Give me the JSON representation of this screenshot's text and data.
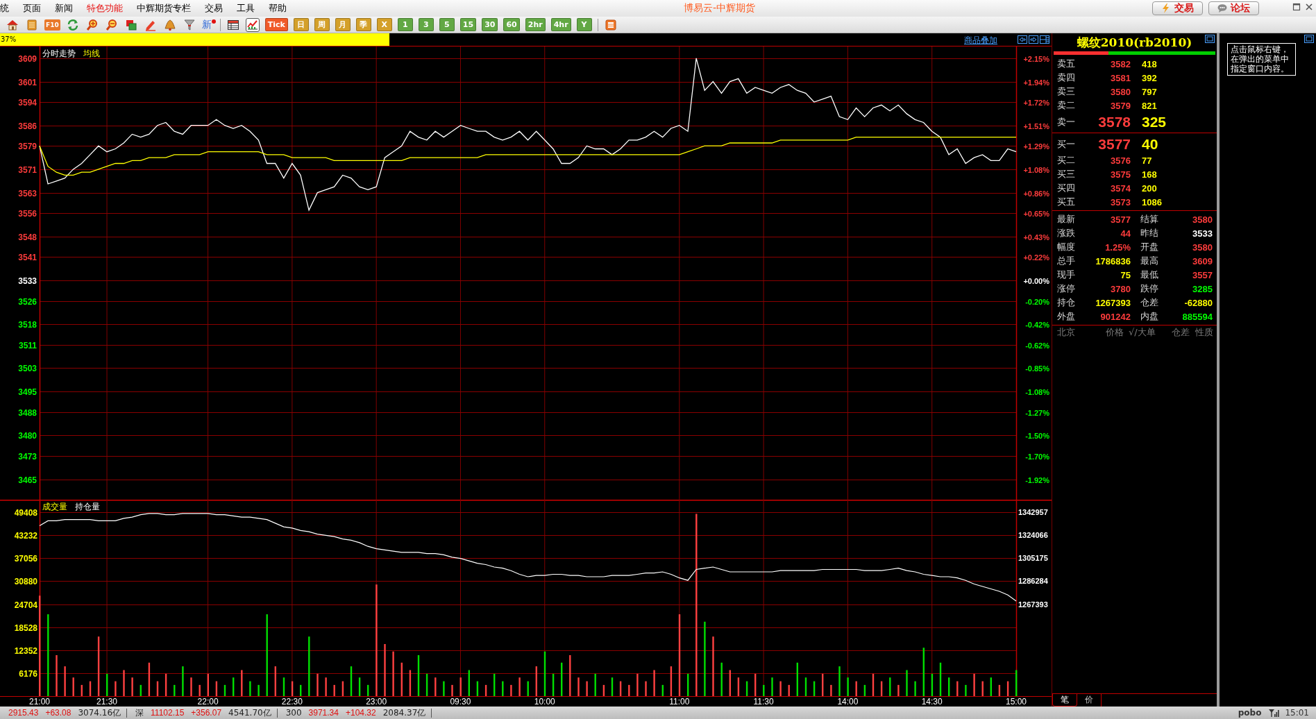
{
  "menu_bar": {
    "items": [
      {
        "label": "统",
        "highlighted": false
      },
      {
        "label": "页面",
        "highlighted": false
      },
      {
        "label": "新闻",
        "highlighted": false
      },
      {
        "label": "特色功能",
        "highlighted": true
      },
      {
        "label": "中辉期货专栏",
        "highlighted": false
      },
      {
        "label": "交易",
        "highlighted": false
      },
      {
        "label": "工具",
        "highlighted": false
      },
      {
        "label": "帮助",
        "highlighted": false
      }
    ],
    "title": "博易云-中辉期货",
    "buttons": [
      {
        "kind": "trade",
        "label": "交易"
      },
      {
        "kind": "forum",
        "label": "论坛"
      }
    ]
  },
  "toolbar": [
    {
      "kind": "icon",
      "selected": false
    },
    {
      "kind": "icon",
      "selected": false
    },
    {
      "kind": "badge",
      "label": "F10",
      "selected": false
    },
    {
      "kind": "icon",
      "selected": false
    },
    {
      "kind": "icon",
      "selected": false
    },
    {
      "kind": "icon",
      "selected": false
    },
    {
      "kind": "icon",
      "selected": false
    },
    {
      "kind": "icon",
      "selected": false
    },
    {
      "kind": "icon",
      "selected": false
    },
    {
      "kind": "icon",
      "selected": false
    },
    {
      "kind": "news",
      "label": "新",
      "selected": false
    },
    {
      "kind": "separator"
    },
    {
      "kind": "icon",
      "selected": false
    },
    {
      "kind": "icon",
      "selected": true
    },
    {
      "kind": "period",
      "label": "Tick",
      "color": "#f05a28",
      "selected": false
    },
    {
      "kind": "period",
      "label": "日",
      "color": "#d4a02a",
      "selected": false
    },
    {
      "kind": "period",
      "label": "周",
      "color": "#d4a02a",
      "selected": false
    },
    {
      "kind": "period",
      "label": "月",
      "color": "#d4a02a",
      "selected": false
    },
    {
      "kind": "period",
      "label": "季",
      "color": "#d4a02a",
      "selected": false
    },
    {
      "kind": "period",
      "label": "X",
      "color": "#d4a02a",
      "selected": false
    },
    {
      "kind": "period",
      "label": "1",
      "color": "#62a844",
      "selected": false
    },
    {
      "kind": "period",
      "label": "3",
      "color": "#62a844",
      "selected": false
    },
    {
      "kind": "period",
      "label": "5",
      "color": "#62a844",
      "selected": false
    },
    {
      "kind": "period",
      "label": "15",
      "color": "#62a844",
      "selected": false
    },
    {
      "kind": "period",
      "label": "30",
      "color": "#62a844",
      "selected": false
    },
    {
      "kind": "period",
      "label": "60",
      "color": "#62a844",
      "selected": false
    },
    {
      "kind": "period",
      "label": "2hr",
      "color": "#62a844",
      "selected": false
    },
    {
      "kind": "period",
      "label": "4hr",
      "color": "#62a844",
      "selected": false
    },
    {
      "kind": "period",
      "label": "Y",
      "color": "#62a844",
      "selected": false
    },
    {
      "kind": "separator"
    },
    {
      "kind": "icon",
      "selected": false
    }
  ],
  "progress": {
    "label": "37%",
    "level": 0.37
  },
  "overlay_link": "商品叠加",
  "price_panel": {
    "percent_labels": [
      "+2.15%",
      "+1.94%",
      "+1.72%",
      "+1.51%",
      "+1.29%",
      "+1.08%",
      "+0.86%",
      "+0.65%",
      "+0.43%",
      "+0.22%",
      "+0.00%",
      "-0.20%",
      "-0.42%",
      "-0.62%",
      "-0.85%",
      "-1.08%",
      "-1.27%",
      "-1.50%",
      "-1.70%",
      "-1.92%"
    ],
    "chart_data": {
      "type": "line",
      "grid": true,
      "ylim": [
        3458,
        3613
      ],
      "yticks": [
        3609,
        3601,
        3594,
        3586,
        3579,
        3571,
        3563,
        3556,
        3548,
        3541,
        3533,
        3526,
        3518,
        3511,
        3503,
        3495,
        3488,
        3480,
        3473,
        3465
      ],
      "series": [
        {
          "name": "分时走势",
          "color": "#ffffff",
          "values": [
            3579,
            3566,
            3567,
            3568,
            3571,
            3573,
            3576,
            3579,
            3577,
            3578,
            3580,
            3583,
            3582,
            3583,
            3586,
            3587,
            3584,
            3583,
            3586,
            3586,
            3586,
            3588,
            3586,
            3585,
            3586,
            3584,
            3581,
            3573,
            3573,
            3568,
            3573,
            3569,
            3557,
            3563,
            3564,
            3565,
            3569,
            3568,
            3565,
            3564,
            3565,
            3575,
            3577,
            3579,
            3584,
            3582,
            3581,
            3584,
            3582,
            3584,
            3586,
            3585,
            3584,
            3584,
            3582,
            3581,
            3582,
            3584,
            3581,
            3584,
            3581,
            3578,
            3573,
            3573,
            3575,
            3579,
            3578,
            3578,
            3576,
            3578,
            3581,
            3581,
            3582,
            3584,
            3582,
            3585,
            3586,
            3584,
            3609,
            3598,
            3601,
            3597,
            3601,
            3602,
            3597,
            3599,
            3598,
            3597,
            3599,
            3600,
            3598,
            3597,
            3594,
            3595,
            3596,
            3589,
            3588,
            3592,
            3589,
            3592,
            3593,
            3591,
            3593,
            3590,
            3588,
            3587,
            3584,
            3582,
            3576,
            3578,
            3573,
            3575,
            3576,
            3574,
            3574,
            3578,
            3577
          ]
        },
        {
          "name": "均线",
          "color": "#ffff00",
          "values": [
            3579,
            3572,
            3570,
            3569,
            3569,
            3570,
            3570,
            3571,
            3572,
            3573,
            3573,
            3574,
            3574,
            3575,
            3575,
            3575,
            3576,
            3576,
            3576,
            3576,
            3577,
            3577,
            3577,
            3577,
            3577,
            3577,
            3577,
            3576,
            3576,
            3576,
            3575,
            3575,
            3575,
            3575,
            3575,
            3574,
            3574,
            3574,
            3574,
            3574,
            3574,
            3574,
            3574,
            3574,
            3575,
            3575,
            3575,
            3575,
            3575,
            3575,
            3575,
            3575,
            3575,
            3576,
            3576,
            3576,
            3576,
            3576,
            3576,
            3576,
            3576,
            3576,
            3576,
            3576,
            3576,
            3576,
            3576,
            3576,
            3576,
            3576,
            3576,
            3576,
            3576,
            3576,
            3576,
            3576,
            3576,
            3577,
            3578,
            3579,
            3579,
            3579,
            3580,
            3580,
            3580,
            3580,
            3580,
            3580,
            3581,
            3581,
            3581,
            3581,
            3581,
            3581,
            3581,
            3581,
            3581,
            3582,
            3582,
            3582,
            3582,
            3582,
            3582,
            3582,
            3582,
            3582,
            3582,
            3582,
            3582,
            3582,
            3582,
            3582,
            3582,
            3582,
            3582,
            3582,
            3582
          ]
        }
      ]
    }
  },
  "volume_panel": {
    "chart_data": {
      "type": "bar",
      "grid": true,
      "ylim": [
        0,
        52800
      ],
      "categories": [
        "21:00",
        null,
        null,
        null,
        null,
        null,
        null,
        null,
        "21:30",
        null,
        null,
        null,
        null,
        null,
        null,
        null,
        null,
        null,
        null,
        null,
        "22:00",
        null,
        null,
        null,
        null,
        null,
        null,
        null,
        null,
        null,
        "22:30",
        null,
        null,
        null,
        null,
        null,
        null,
        null,
        null,
        null,
        "23:00",
        null,
        null,
        null,
        null,
        null,
        null,
        null,
        null,
        null,
        "09:30",
        null,
        null,
        null,
        null,
        null,
        null,
        null,
        null,
        null,
        "10:00",
        null,
        null,
        null,
        null,
        null,
        null,
        null,
        null,
        null,
        null,
        null,
        null,
        null,
        null,
        null,
        "11:00",
        null,
        null,
        null,
        null,
        null,
        null,
        null,
        null,
        null,
        "11:30",
        null,
        null,
        null,
        null,
        null,
        null,
        null,
        null,
        null,
        "14:00",
        null,
        null,
        null,
        null,
        null,
        null,
        null,
        null,
        null,
        "14:30",
        null,
        null,
        null,
        null,
        null,
        null,
        null,
        null,
        null,
        "15:00"
      ],
      "yticks": [
        49408,
        43232,
        37056,
        30880,
        24704,
        18528,
        12352,
        6176
      ],
      "series": [
        {
          "name": "成交量",
          "values": [
            27000,
            22000,
            11000,
            8000,
            5000,
            3000,
            4000,
            16000,
            6000,
            4000,
            7000,
            5000,
            3000,
            9000,
            4000,
            6000,
            3000,
            8000,
            5000,
            3000,
            6000,
            4000,
            3000,
            5000,
            7000,
            4000,
            3000,
            22000,
            8000,
            5000,
            4000,
            3000,
            16000,
            6000,
            5000,
            3000,
            4000,
            8000,
            5000,
            3000,
            30000,
            14000,
            12000,
            9000,
            7000,
            11000,
            6000,
            5000,
            4000,
            3000,
            5000,
            7000,
            4000,
            3000,
            6000,
            4000,
            3000,
            5000,
            4000,
            8000,
            12000,
            6000,
            9000,
            11000,
            5000,
            4000,
            6000,
            3000,
            5000,
            4000,
            3000,
            6000,
            4000,
            7000,
            3000,
            8000,
            22000,
            6000,
            49000,
            20000,
            16000,
            9000,
            7000,
            5000,
            4000,
            6000,
            3000,
            5000,
            4000,
            3000,
            9000,
            5000,
            4000,
            6000,
            3000,
            8000,
            5000,
            4000,
            3000,
            6000,
            4000,
            5000,
            3000,
            7000,
            4000,
            13000,
            6000,
            9000,
            5000,
            4000,
            3000,
            6000,
            4000,
            5000,
            3000,
            4000,
            7000
          ]
        }
      ]
    }
  },
  "open_interest_panel": {
    "chart_data": {
      "type": "line",
      "ylim": [
        1267393,
        1342957
      ],
      "yticks": [
        1342957,
        1324066,
        1305175,
        1286284,
        1267393
      ],
      "series": [
        {
          "name": "持仓量",
          "color": "#ffffff",
          "values": [
            1332000,
            1336000,
            1336000,
            1337000,
            1337000,
            1337000,
            1337000,
            1336000,
            1336000,
            1336000,
            1338000,
            1339000,
            1341000,
            1342000,
            1342000,
            1341000,
            1341000,
            1342000,
            1342000,
            1342000,
            1342000,
            1341000,
            1341000,
            1340000,
            1339000,
            1339000,
            1338000,
            1337000,
            1334000,
            1331000,
            1330000,
            1328000,
            1327000,
            1325000,
            1324000,
            1323000,
            1321000,
            1320000,
            1318000,
            1315000,
            1313000,
            1312000,
            1311000,
            1310000,
            1310000,
            1310000,
            1309000,
            1309000,
            1308000,
            1306000,
            1305000,
            1303000,
            1301000,
            1300000,
            1298000,
            1297000,
            1295000,
            1292000,
            1290000,
            1291000,
            1291000,
            1292000,
            1292000,
            1291000,
            1291000,
            1290000,
            1290000,
            1290000,
            1291000,
            1291000,
            1291000,
            1292000,
            1293000,
            1293000,
            1294000,
            1292000,
            1289000,
            1287000,
            1296000,
            1297000,
            1298000,
            1296000,
            1294000,
            1294000,
            1294000,
            1294000,
            1294000,
            1294000,
            1295000,
            1295000,
            1295000,
            1295000,
            1295000,
            1296000,
            1296000,
            1296000,
            1296000,
            1296000,
            1295000,
            1295000,
            1295000,
            1296000,
            1297000,
            1295000,
            1294000,
            1292000,
            1291000,
            1290000,
            1290000,
            1289000,
            1287000,
            1284000,
            1282000,
            1280000,
            1278000,
            1275000,
            1270000
          ]
        }
      ]
    }
  },
  "quote": {
    "title": "螺纹2010(rb2010)",
    "buy_sell_ratio": {
      "level": 0.34
    },
    "asks": [
      {
        "kind": "level",
        "label": "卖五",
        "price": "3582",
        "volume": "418"
      },
      {
        "kind": "level",
        "label": "卖四",
        "price": "3581",
        "volume": "392"
      },
      {
        "kind": "level",
        "label": "卖三",
        "price": "3580",
        "volume": "797"
      },
      {
        "kind": "level",
        "label": "卖二",
        "price": "3579",
        "volume": "821"
      },
      {
        "kind": "best",
        "label": "卖一",
        "price": "3578",
        "volume": "325"
      }
    ],
    "bids": [
      {
        "kind": "best",
        "label": "买一",
        "price": "3577",
        "volume": "40"
      },
      {
        "kind": "level",
        "label": "买二",
        "price": "3576",
        "volume": "77"
      },
      {
        "kind": "level",
        "label": "买三",
        "price": "3575",
        "volume": "168"
      },
      {
        "kind": "level",
        "label": "买四",
        "price": "3574",
        "volume": "200"
      },
      {
        "kind": "level",
        "label": "买五",
        "price": "3573",
        "volume": "1086"
      }
    ],
    "stats": [
      {
        "label": "最新",
        "value": "3577",
        "color": "#ff3c3c"
      },
      {
        "label": "结算",
        "value": "3580",
        "color": "#ff3c3c"
      },
      {
        "label": "涨跌",
        "value": "44",
        "color": "#ff3c3c"
      },
      {
        "label": "昨结",
        "value": "3533",
        "color": "#ffffff"
      },
      {
        "label": "幅度",
        "value": "1.25%",
        "color": "#ff3c3c"
      },
      {
        "label": "开盘",
        "value": "3580",
        "color": "#ff3c3c"
      },
      {
        "label": "总手",
        "value": "1786836",
        "color": "#ffff00"
      },
      {
        "label": "最高",
        "value": "3609",
        "color": "#ff3c3c"
      },
      {
        "label": "现手",
        "value": "75",
        "color": "#ffff00"
      },
      {
        "label": "最低",
        "value": "3557",
        "color": "#ff3c3c"
      },
      {
        "label": "涨停",
        "value": "3780",
        "color": "#ff3c3c"
      },
      {
        "label": "跌停",
        "value": "3285",
        "color": "#00ff00"
      },
      {
        "label": "持仓",
        "value": "1267393",
        "color": "#ffff00"
      },
      {
        "label": "仓差",
        "value": "-62880",
        "color": "#ffff00"
      },
      {
        "label": "外盘",
        "value": "901242",
        "color": "#ff3c3c"
      },
      {
        "label": "内盘",
        "value": "885594",
        "color": "#00ff00"
      }
    ],
    "trade_columns": [
      "北京",
      "价格",
      "√/大单",
      "仓差",
      "性质"
    ],
    "tabs": [
      {
        "label": "笔",
        "selected": true
      },
      {
        "label": "价",
        "selected": false
      }
    ]
  },
  "note": "点击鼠标右键，在弹出的菜单中指定窗口内容。",
  "status_bar": {
    "indices": [
      {
        "value": "2915.43",
        "change": "+63.08",
        "amount": "3074.16亿"
      },
      {
        "name": "深",
        "value": "11102.15",
        "change": "+356.07",
        "amount": "4541.70亿"
      },
      {
        "name": "300",
        "value": "3971.34",
        "change": "+104.32",
        "amount": "2084.37亿"
      }
    ],
    "brand": "pobo",
    "time": "15:01"
  }
}
